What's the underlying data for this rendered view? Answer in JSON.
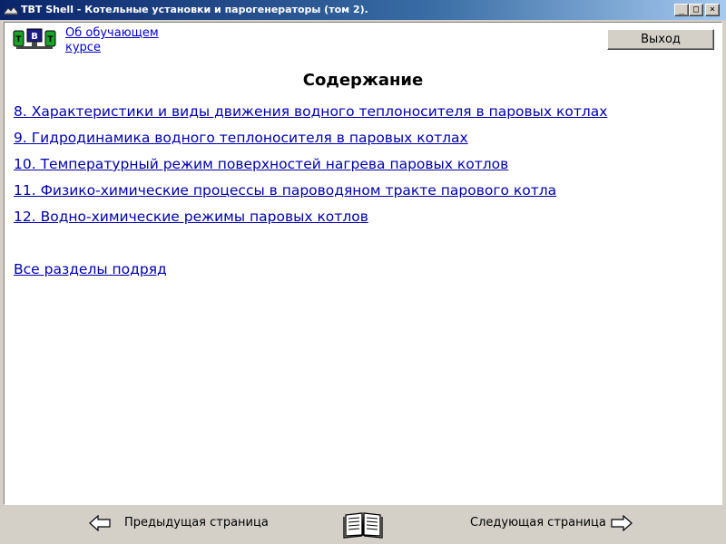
{
  "window": {
    "title": "TBT Shell - Котельные установки и парогенераторы (том 2).",
    "minimize_glyph": "_",
    "maximize_glyph": "□",
    "close_glyph": "×"
  },
  "header": {
    "logo_icon": "tbt-logo-icon",
    "about_link": "Об обучающем курсе",
    "exit_button": "Выход"
  },
  "main": {
    "title": "Содержание",
    "toc": [
      {
        "label": "8. Характеристики и виды движения водного теплоносителя в паровых котлах"
      },
      {
        "label": "9. Гидродинамика водного теплоносителя в паровых котлах"
      },
      {
        "label": "10. Температурный режим поверхностей нагрева паровых котлов"
      },
      {
        "label": "11. Физико-химические процессы в пароводяном тракте парового котла"
      },
      {
        "label": "12. Водно-химические режимы паровых котлов"
      }
    ],
    "all_sections": "Все разделы подряд"
  },
  "navigation": {
    "prev_label": "Предыдущая страница",
    "next_label": "Следующая страница",
    "prev_icon": "arrow-left-icon",
    "next_icon": "arrow-right-icon",
    "book_icon": "book-icon"
  }
}
